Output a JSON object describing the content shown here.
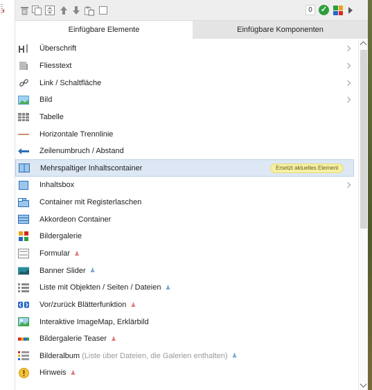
{
  "toolbar": {
    "counter": "0"
  },
  "tabs": [
    {
      "label": "Einfügbare Elemente",
      "active": true
    },
    {
      "label": "Einfügbare Komponenten",
      "active": false
    }
  ],
  "items": [
    {
      "label": "Überschrift",
      "icon": "heading-icon",
      "submenu": true
    },
    {
      "label": "Fliesstext",
      "icon": "text-icon",
      "submenu": true
    },
    {
      "label": "Link / Schaltfläche",
      "icon": "link-icon",
      "submenu": true
    },
    {
      "label": "Bild",
      "icon": "image-icon",
      "submenu": true
    },
    {
      "label": "Tabelle",
      "icon": "table-icon"
    },
    {
      "label": "Horizontale Trennlinie",
      "icon": "divider-icon"
    },
    {
      "label": "Zeilenumbruch / Abstand",
      "icon": "line-break-icon"
    },
    {
      "label": "Mehrspaltiger Inhaltscontainer",
      "icon": "columns-icon",
      "badge": "Ersetzt aktuelles Element"
    },
    {
      "label": "Inhaltsbox",
      "icon": "box-icon",
      "submenu": true
    },
    {
      "label": "Container mit Registerlaschen",
      "icon": "tabs-container-icon"
    },
    {
      "label": "Akkordeon Container",
      "icon": "accordion-icon"
    },
    {
      "label": "Bildergalerie",
      "icon": "gallery-icon"
    },
    {
      "label": "Formular",
      "icon": "form-icon",
      "restricted": true
    },
    {
      "label": "Banner Slider",
      "icon": "banner-slider-icon",
      "restricted": true
    },
    {
      "label": "Liste mit Objekten / Seiten / Dateien",
      "icon": "object-list-icon",
      "restricted": true
    },
    {
      "label": "Vor/zurück Blätterfunktion",
      "icon": "pager-icon",
      "restricted": true
    },
    {
      "label": "Interaktive ImageMap, Erklärbild",
      "icon": "imagemap-icon"
    },
    {
      "label": "Bildergalerie Teaser",
      "icon": "gallery-teaser-icon",
      "restricted": true
    },
    {
      "label": "Bilderalbum",
      "note": "(Liste über Dateien, die Galerien enthalten)",
      "icon": "album-icon",
      "restricted": true
    },
    {
      "label": "Hinweis",
      "icon": "notice-icon",
      "restricted": true
    }
  ],
  "colors": {
    "restricted_user": "#e07a7a",
    "info_user": "#7aa7d9",
    "highlight": "#dde8f4",
    "badge": "#f5f0a5"
  }
}
